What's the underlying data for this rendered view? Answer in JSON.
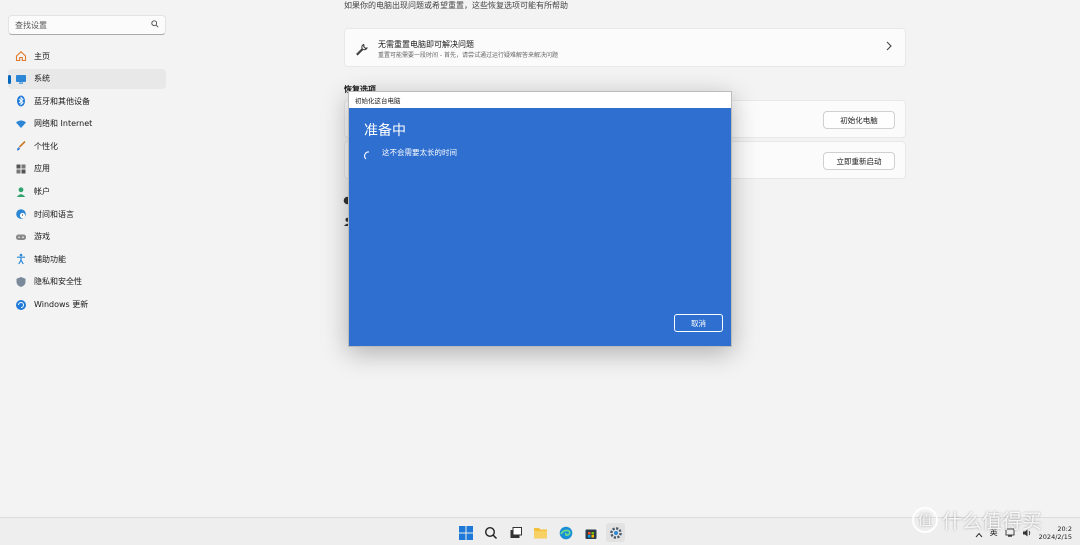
{
  "sidebar": {
    "search_placeholder": "查找设置",
    "items": [
      {
        "label": "主页",
        "icon": "home-icon"
      },
      {
        "label": "系统",
        "icon": "system-icon",
        "active": true
      },
      {
        "label": "蓝牙和其他设备",
        "icon": "bluetooth-icon"
      },
      {
        "label": "网络和 Internet",
        "icon": "wifi-icon"
      },
      {
        "label": "个性化",
        "icon": "brush-icon"
      },
      {
        "label": "应用",
        "icon": "apps-icon"
      },
      {
        "label": "帐户",
        "icon": "account-icon"
      },
      {
        "label": "时间和语言",
        "icon": "globe-clock-icon"
      },
      {
        "label": "游戏",
        "icon": "gamepad-icon"
      },
      {
        "label": "辅助功能",
        "icon": "accessibility-icon"
      },
      {
        "label": "隐私和安全性",
        "icon": "shield-icon"
      },
      {
        "label": "Windows 更新",
        "icon": "update-icon"
      }
    ]
  },
  "main": {
    "top_description": "如果你的电脑出现问题或希望重置，这些恢复选项可能有所帮助",
    "troubleshoot_card": {
      "title": "无需重置电脑即可解决问题",
      "subtitle": "重置可能需要一段时间 - 首先，请尝试通过运行疑难解答来解决问题"
    },
    "section_label": "恢复选项",
    "reset_button": "初始化电脑",
    "restart_button": "立即重新启动"
  },
  "dialog": {
    "title": "初始化这台电脑",
    "heading": "准备中",
    "message": "这不会需要太长的时间",
    "cancel_label": "取消"
  },
  "taskbar": {
    "ime": "英",
    "time": "20:2",
    "date": "2024/2/15"
  },
  "watermark": {
    "badge": "值",
    "text": "什么值得买"
  },
  "colors": {
    "accent": "#0067c0",
    "dialog_bg": "#2e6fcf"
  }
}
